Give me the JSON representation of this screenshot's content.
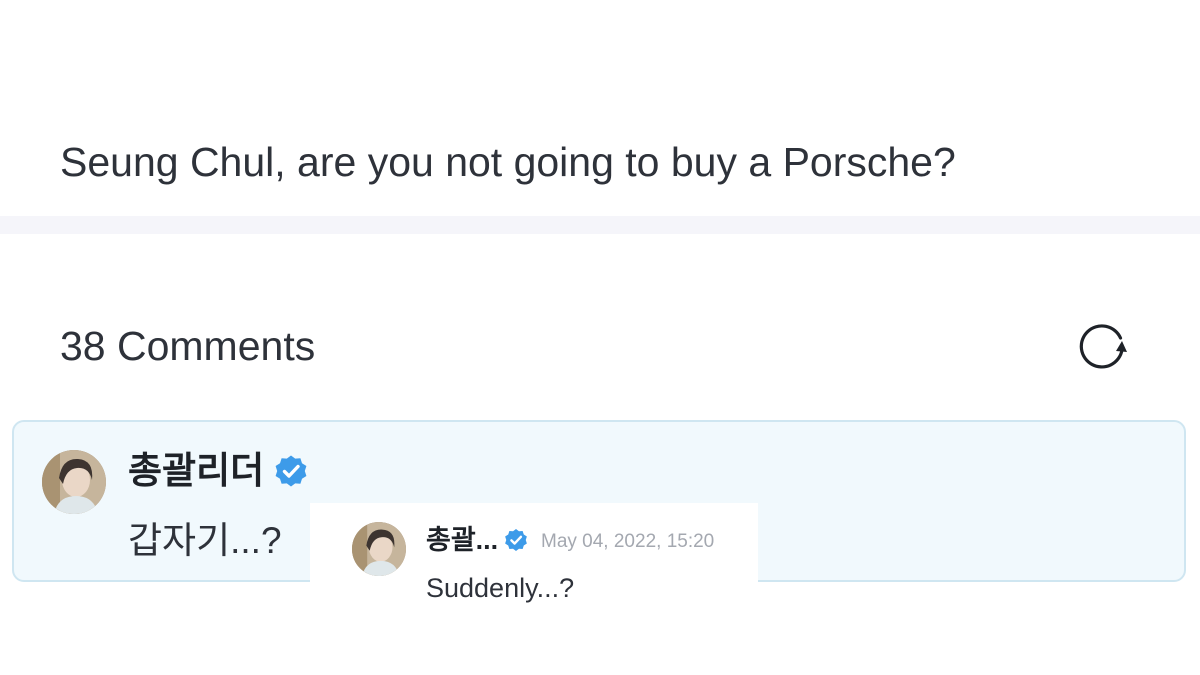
{
  "post": {
    "text": "Seung Chul, are you not going to buy a Porsche?"
  },
  "comments": {
    "title": "38 Comments",
    "refresh_icon": "refresh-icon"
  },
  "comment": {
    "author": "총괄리더",
    "verified_icon": "verified-badge-icon",
    "text": "갑자기...?"
  },
  "translation": {
    "author": "총괄...",
    "timestamp": "May 04, 2022, 15:20",
    "text": "Suddenly...?"
  },
  "colors": {
    "verified": "#3d9be9",
    "card_background": "#f1f9fd",
    "card_border": "#cfe6f1",
    "divider": "#f5f5fa",
    "timestamp": "#a4a8b0"
  }
}
